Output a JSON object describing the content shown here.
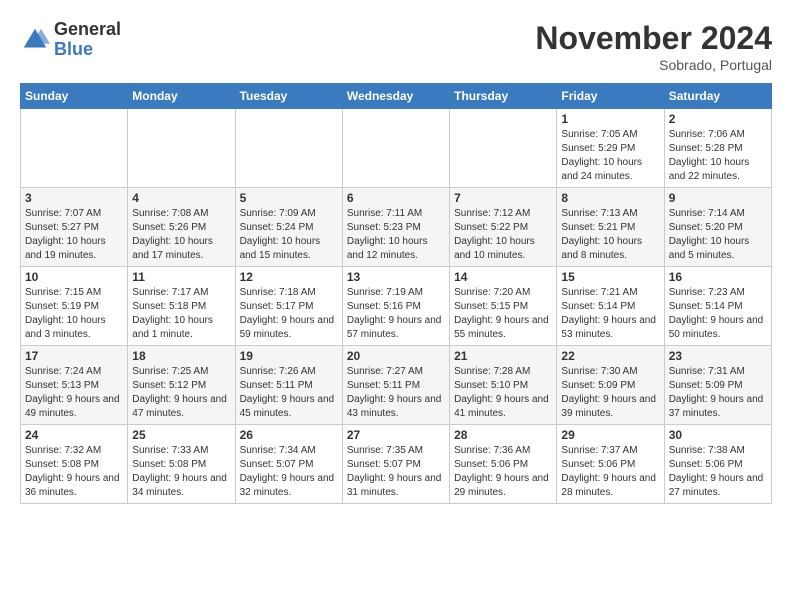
{
  "logo": {
    "general": "General",
    "blue": "Blue"
  },
  "title": "November 2024",
  "subtitle": "Sobrado, Portugal",
  "weekdays": [
    "Sunday",
    "Monday",
    "Tuesday",
    "Wednesday",
    "Thursday",
    "Friday",
    "Saturday"
  ],
  "weeks": [
    [
      {
        "day": "",
        "info": ""
      },
      {
        "day": "",
        "info": ""
      },
      {
        "day": "",
        "info": ""
      },
      {
        "day": "",
        "info": ""
      },
      {
        "day": "",
        "info": ""
      },
      {
        "day": "1",
        "info": "Sunrise: 7:05 AM\nSunset: 5:29 PM\nDaylight: 10 hours and 24 minutes."
      },
      {
        "day": "2",
        "info": "Sunrise: 7:06 AM\nSunset: 5:28 PM\nDaylight: 10 hours and 22 minutes."
      }
    ],
    [
      {
        "day": "3",
        "info": "Sunrise: 7:07 AM\nSunset: 5:27 PM\nDaylight: 10 hours and 19 minutes."
      },
      {
        "day": "4",
        "info": "Sunrise: 7:08 AM\nSunset: 5:26 PM\nDaylight: 10 hours and 17 minutes."
      },
      {
        "day": "5",
        "info": "Sunrise: 7:09 AM\nSunset: 5:24 PM\nDaylight: 10 hours and 15 minutes."
      },
      {
        "day": "6",
        "info": "Sunrise: 7:11 AM\nSunset: 5:23 PM\nDaylight: 10 hours and 12 minutes."
      },
      {
        "day": "7",
        "info": "Sunrise: 7:12 AM\nSunset: 5:22 PM\nDaylight: 10 hours and 10 minutes."
      },
      {
        "day": "8",
        "info": "Sunrise: 7:13 AM\nSunset: 5:21 PM\nDaylight: 10 hours and 8 minutes."
      },
      {
        "day": "9",
        "info": "Sunrise: 7:14 AM\nSunset: 5:20 PM\nDaylight: 10 hours and 5 minutes."
      }
    ],
    [
      {
        "day": "10",
        "info": "Sunrise: 7:15 AM\nSunset: 5:19 PM\nDaylight: 10 hours and 3 minutes."
      },
      {
        "day": "11",
        "info": "Sunrise: 7:17 AM\nSunset: 5:18 PM\nDaylight: 10 hours and 1 minute."
      },
      {
        "day": "12",
        "info": "Sunrise: 7:18 AM\nSunset: 5:17 PM\nDaylight: 9 hours and 59 minutes."
      },
      {
        "day": "13",
        "info": "Sunrise: 7:19 AM\nSunset: 5:16 PM\nDaylight: 9 hours and 57 minutes."
      },
      {
        "day": "14",
        "info": "Sunrise: 7:20 AM\nSunset: 5:15 PM\nDaylight: 9 hours and 55 minutes."
      },
      {
        "day": "15",
        "info": "Sunrise: 7:21 AM\nSunset: 5:14 PM\nDaylight: 9 hours and 53 minutes."
      },
      {
        "day": "16",
        "info": "Sunrise: 7:23 AM\nSunset: 5:14 PM\nDaylight: 9 hours and 50 minutes."
      }
    ],
    [
      {
        "day": "17",
        "info": "Sunrise: 7:24 AM\nSunset: 5:13 PM\nDaylight: 9 hours and 49 minutes."
      },
      {
        "day": "18",
        "info": "Sunrise: 7:25 AM\nSunset: 5:12 PM\nDaylight: 9 hours and 47 minutes."
      },
      {
        "day": "19",
        "info": "Sunrise: 7:26 AM\nSunset: 5:11 PM\nDaylight: 9 hours and 45 minutes."
      },
      {
        "day": "20",
        "info": "Sunrise: 7:27 AM\nSunset: 5:11 PM\nDaylight: 9 hours and 43 minutes."
      },
      {
        "day": "21",
        "info": "Sunrise: 7:28 AM\nSunset: 5:10 PM\nDaylight: 9 hours and 41 minutes."
      },
      {
        "day": "22",
        "info": "Sunrise: 7:30 AM\nSunset: 5:09 PM\nDaylight: 9 hours and 39 minutes."
      },
      {
        "day": "23",
        "info": "Sunrise: 7:31 AM\nSunset: 5:09 PM\nDaylight: 9 hours and 37 minutes."
      }
    ],
    [
      {
        "day": "24",
        "info": "Sunrise: 7:32 AM\nSunset: 5:08 PM\nDaylight: 9 hours and 36 minutes."
      },
      {
        "day": "25",
        "info": "Sunrise: 7:33 AM\nSunset: 5:08 PM\nDaylight: 9 hours and 34 minutes."
      },
      {
        "day": "26",
        "info": "Sunrise: 7:34 AM\nSunset: 5:07 PM\nDaylight: 9 hours and 32 minutes."
      },
      {
        "day": "27",
        "info": "Sunrise: 7:35 AM\nSunset: 5:07 PM\nDaylight: 9 hours and 31 minutes."
      },
      {
        "day": "28",
        "info": "Sunrise: 7:36 AM\nSunset: 5:06 PM\nDaylight: 9 hours and 29 minutes."
      },
      {
        "day": "29",
        "info": "Sunrise: 7:37 AM\nSunset: 5:06 PM\nDaylight: 9 hours and 28 minutes."
      },
      {
        "day": "30",
        "info": "Sunrise: 7:38 AM\nSunset: 5:06 PM\nDaylight: 9 hours and 27 minutes."
      }
    ]
  ]
}
